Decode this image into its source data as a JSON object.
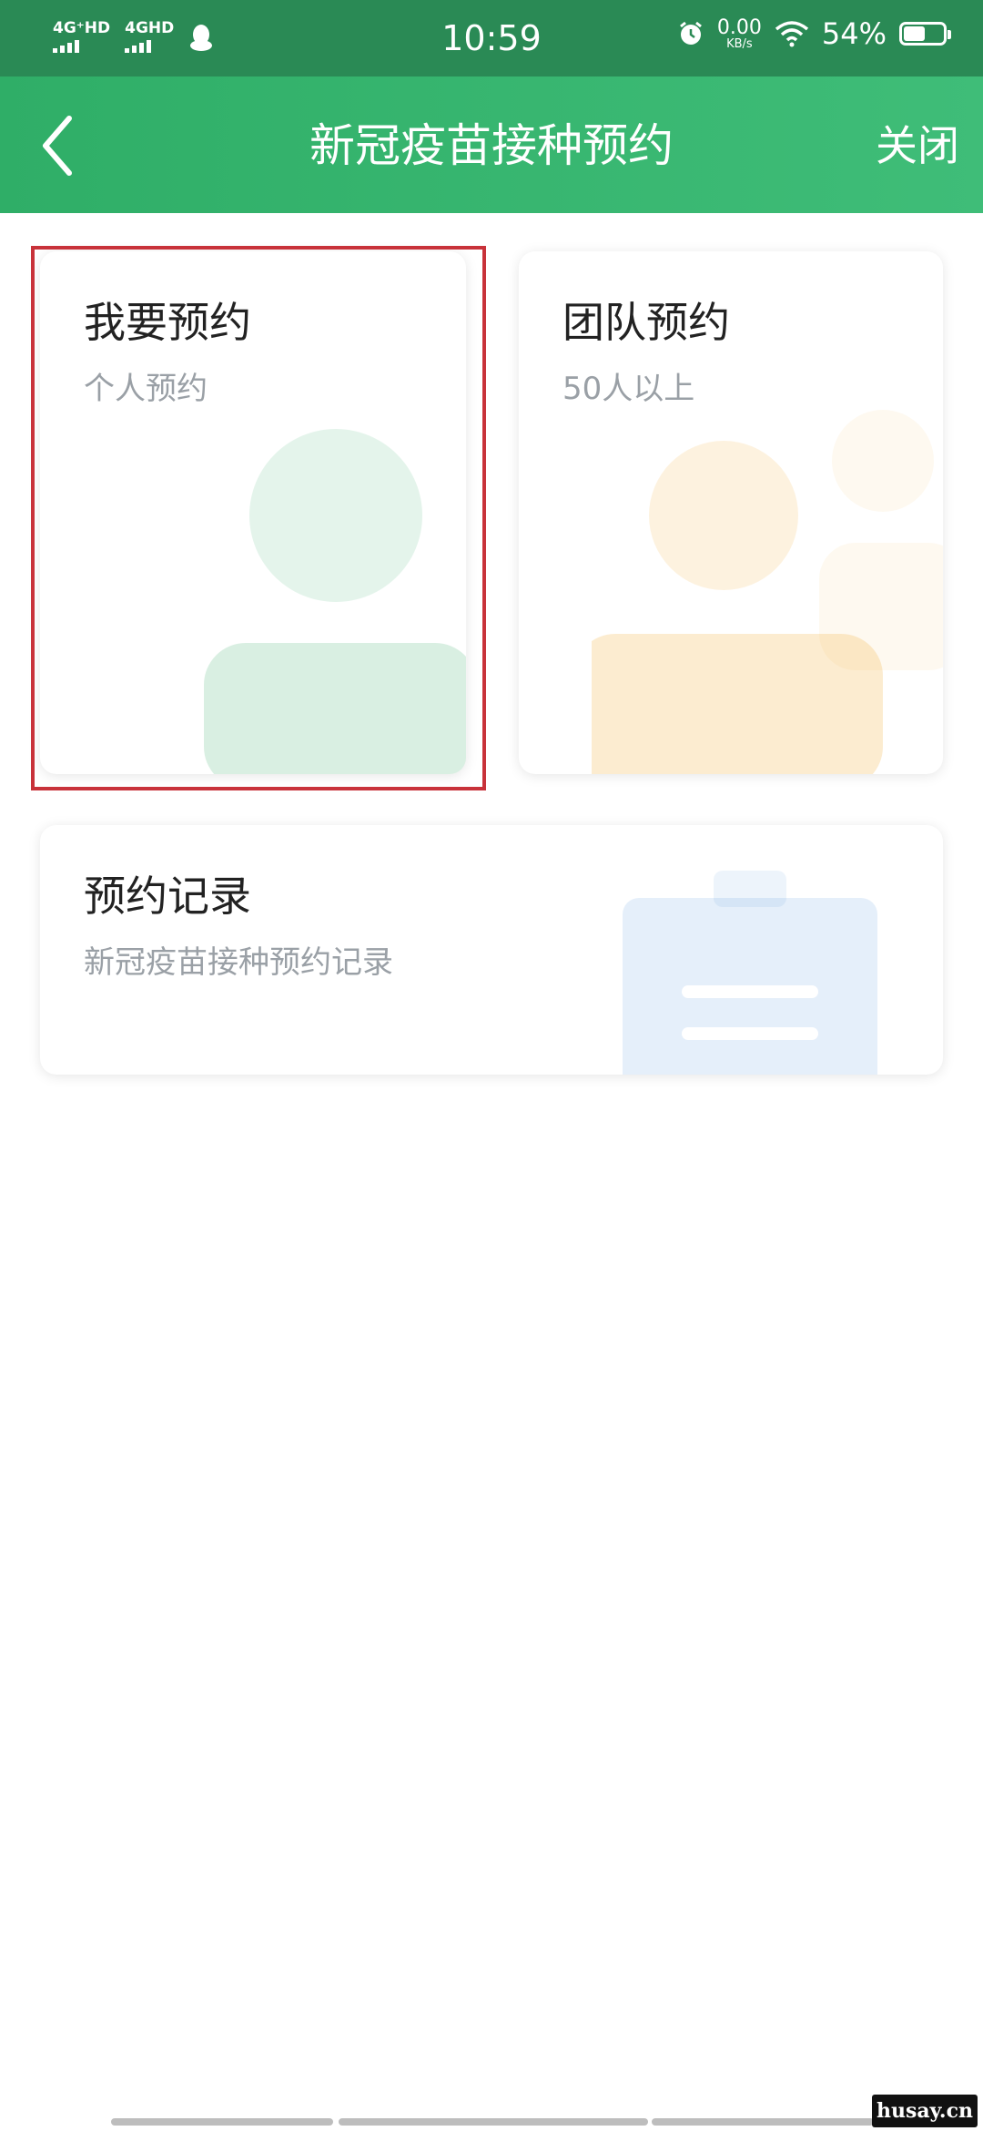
{
  "status_bar": {
    "sim1": "4G⁺HD",
    "sim2": "4GHD",
    "time": "10:59",
    "net_speed_value": "0.00",
    "net_speed_unit": "KB/s",
    "battery_percent": "54%",
    "battery_level": 0.54,
    "icons": [
      "signal-icon",
      "qq-icon",
      "alarm-icon",
      "wifi-icon",
      "battery-icon"
    ]
  },
  "navbar": {
    "title": "新冠疫苗接种预约",
    "close_label": "关闭",
    "back_icon": "chevron-left-icon"
  },
  "cards": {
    "personal": {
      "title": "我要预约",
      "subtitle": "个人预约",
      "color": "#3fb06e"
    },
    "team": {
      "title": "团队预约",
      "subtitle": "50人以上",
      "color": "#f3b13b"
    },
    "records": {
      "title": "预约记录",
      "subtitle": "新冠疫苗接种预约记录",
      "color": "#4a90d9"
    }
  },
  "watermark": "husay.cn",
  "colors": {
    "brand_green": "#2fae67",
    "highlight_red": "#c8323a"
  }
}
